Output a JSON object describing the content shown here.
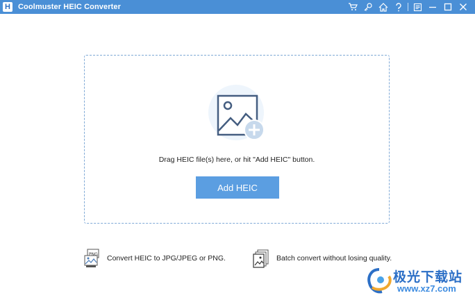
{
  "window": {
    "logo_letter": "H",
    "title": "Coolmuster HEIC Converter",
    "toolbar_icons": [
      "cart-icon",
      "key-icon",
      "home-icon",
      "help-icon",
      "feedback-icon",
      "minimize-icon",
      "maximize-icon",
      "close-icon"
    ]
  },
  "dropzone": {
    "instruction": "Drag HEIC file(s) here, or hit \"Add HEIC\" button.",
    "add_button_label": "Add HEIC",
    "illustration_icon": "image-add-icon"
  },
  "features": [
    {
      "icon": "image-formats-icon",
      "label": "Convert HEIC to JPG/JPEG or PNG."
    },
    {
      "icon": "batch-images-icon",
      "label": "Batch convert without losing quality."
    }
  ],
  "watermark": {
    "name": "极光下载站",
    "url": "www.xz7.com"
  },
  "colors": {
    "titlebar": "#4a8fd6",
    "accent_button": "#5b9ee1",
    "dropzone_border": "#7fa9d6"
  }
}
